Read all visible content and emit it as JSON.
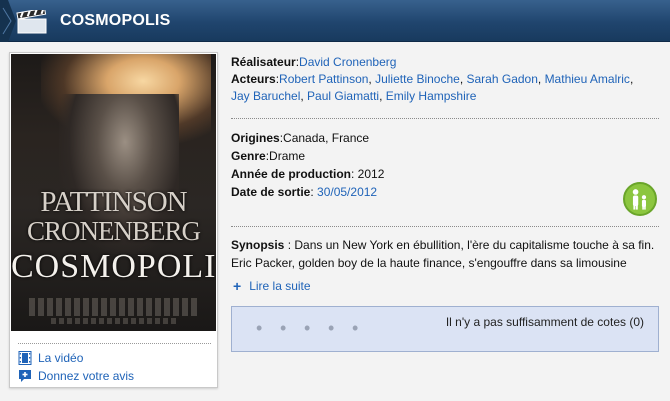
{
  "header": {
    "title": "COSMOPOLIS"
  },
  "poster": {
    "name_line1": "PATTINSON",
    "name_line2": "CRONENBERG",
    "title_line": "COSMOPOLIS"
  },
  "card_links": {
    "video_label": "La vidéo",
    "review_label": "Donnez votre avis"
  },
  "details": {
    "director_label": "Réalisateur",
    "director": "David Cronenberg",
    "actors_label": "Acteurs",
    "actors": [
      "Robert Pattinson",
      "Juliette Binoche",
      "Sarah Gadon",
      "Mathieu Amalric",
      "Jay Baruchel",
      "Paul Giamatti",
      "Emily Hampshire"
    ],
    "origins_label": "Origines",
    "origins": "Canada, France",
    "genre_label": "Genre",
    "genre": "Drame",
    "year_label": "Année de production",
    "year": "2012",
    "release_label": "Date de sortie",
    "release": "30/05/2012"
  },
  "synopsis": {
    "label": "Synopsis",
    "text": "Dans un New York en ébullition, l'ère du capitalisme touche à sa fin. Eric Packer, golden boy de la haute finance, s'engouffre dans sa limousine blanche.",
    "read_more": "Lire la suite"
  },
  "rating": {
    "dots": 5,
    "text": "Il n'y a pas suffisamment de cotes (0)"
  },
  "icons": {
    "header": "clapperboard-icon",
    "video": "film-icon",
    "review": "add-comment-icon",
    "audience": "family-icon",
    "read_more": "plus-icon"
  },
  "colors": {
    "header_bg": "#20456e",
    "link": "#1f63b8",
    "family_badge": "#8cc63f",
    "rating_bg": "#dbe3f4"
  }
}
